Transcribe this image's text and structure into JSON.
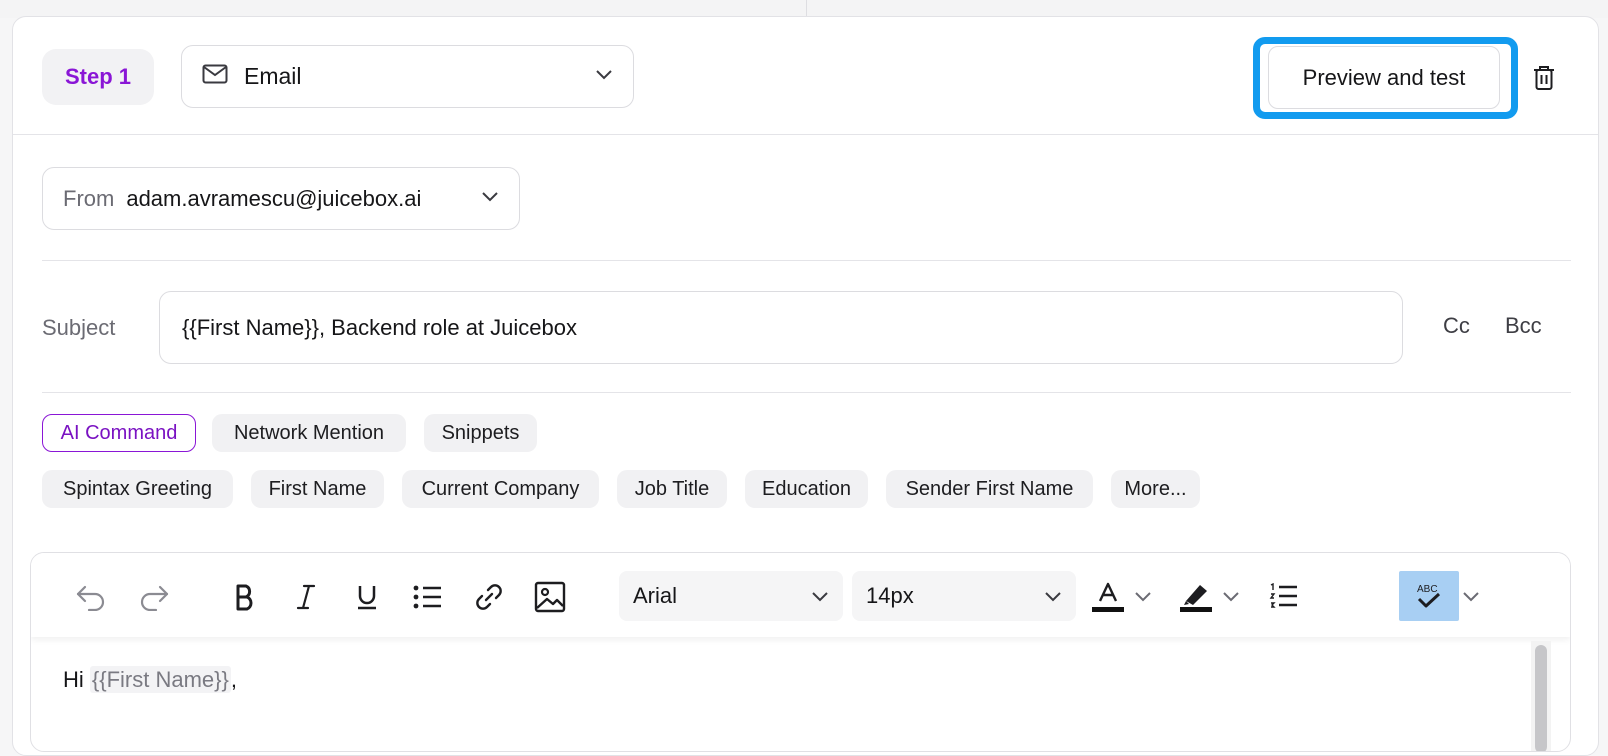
{
  "header": {
    "step_label": "Step 1",
    "channel": {
      "value": "Email",
      "icon": "mail-icon"
    },
    "preview_label": "Preview and test",
    "delete_icon": "trash-icon",
    "highlight_color": "#129bef",
    "accent_color": "#8a16d6"
  },
  "from": {
    "label": "From",
    "value": "adam.avramescu@juicebox.ai"
  },
  "subject": {
    "label": "Subject",
    "value": "{{First Name}}, Backend role at Juicebox",
    "cc_label": "Cc",
    "bcc_label": "Bcc"
  },
  "chips": {
    "row1": [
      "AI Command",
      "Network Mention",
      "Snippets"
    ],
    "row2": [
      "Spintax Greeting",
      "First Name",
      "Current Company",
      "Job Title",
      "Education",
      "Sender First Name",
      "More..."
    ]
  },
  "toolbar": {
    "font_family": "Arial",
    "font_size": "14px",
    "icons": [
      "undo-icon",
      "redo-icon",
      "bold-icon",
      "italic-icon",
      "underline-icon",
      "bullet-list-icon",
      "link-icon",
      "image-icon",
      "text-color-icon",
      "highlight-icon",
      "numbered-list-icon",
      "spellcheck-icon"
    ]
  },
  "body": {
    "greeting": "Hi ",
    "token": "{{First Name}}",
    "punct": ","
  }
}
